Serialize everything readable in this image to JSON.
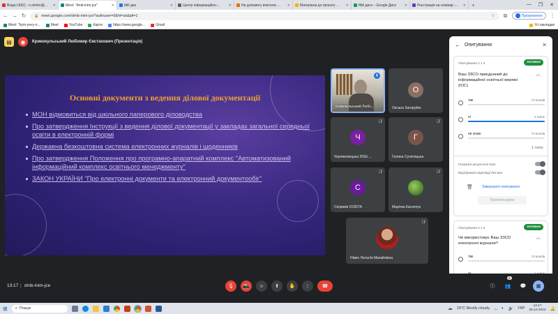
{
  "browser": {
    "tabs": [
      {
        "label": "Вхідні (692) - n.nimko@...",
        "color": "#d93025",
        "active": false
      },
      {
        "label": "Meet: \"dmb-inim-jce\"",
        "color": "#00897b",
        "active": true
      },
      {
        "label": "Mill дик",
        "color": "#1a73e8",
        "active": false
      },
      {
        "label": "Центр інформаційно-...",
        "color": "#5f6368",
        "active": false
      },
      {
        "label": "На допомогу вчителю ...",
        "color": "#e37400",
        "active": false
      },
      {
        "label": "Матеріали до проєкту ...",
        "color": "#f4b400",
        "active": false
      },
      {
        "label": "Мій диск – Google Диск",
        "color": "#0f9d58",
        "active": false
      },
      {
        "label": "Реєстрація на семінар -...",
        "color": "#673ab7",
        "active": false
      }
    ],
    "url": "meet.google.com/dmb-inim-jce?authuser=0&hl=uk&pli=1",
    "profile_label": "Призупинено",
    "bookmarks": [
      {
        "label": "Meet: \"bym-yevy-n...",
        "color": "#00897b"
      },
      {
        "label": "Meet",
        "color": "#00897b"
      },
      {
        "label": "YouTube",
        "color": "#ff0000"
      },
      {
        "label": "Карти",
        "color": "#34a853"
      },
      {
        "label": "https://www.google...",
        "color": "#4285f4"
      },
      {
        "label": "Gmail",
        "color": "#d93025"
      }
    ],
    "all_bookmarks": "Усі закладки"
  },
  "presenter": {
    "title": "Кривокульський Любомир Євстахович (Презентація)"
  },
  "slide": {
    "title": "Основні документи з ведення ділової документації",
    "items": [
      "МОН відмовиться від шкільного паперового діловодства",
      "Про затвердження Інструкції з ведення ділової документації у закладах загальної середньої освіти в електронній формі",
      "Державна безкоштовна система електронних журналів і щоденників",
      "Про затвердження Положення про програмно-апаратний комплекс \"Автоматизований інформаційний комплекс освітнього менеджменту\"",
      "ЗАКОН УКРАЇНИ \"Про електронні документи та електронний документообіг\""
    ]
  },
  "participants": [
    {
      "name": "Кривокульський Любо...",
      "type": "video"
    },
    {
      "name": "Оксана Загоруйко",
      "initial": "О",
      "color": "#8d6e63"
    },
    {
      "name": "Черчиковецька ЗОШ ...",
      "initial": "Ч",
      "color": "#7b1fa2"
    },
    {
      "name": "Галина Сулятицька",
      "initial": "Г",
      "color": "#795548"
    },
    {
      "name": "Скориків ОСВІТА",
      "initial": "С",
      "color": "#6a1b9a"
    },
    {
      "name": "Марічка Касянчук",
      "type": "photo"
    },
    {
      "name": "Німко Наталія Михайлівна",
      "type": "photo"
    }
  ],
  "panel": {
    "title": "Опитування",
    "poll1": {
      "meta": "Опитування 1 з 3",
      "status": "Активне",
      "question": "Ваш ЗЗСО приєднаний до інформаційної освітньої мережі (ІОС)",
      "options": [
        {
          "label": "так",
          "count": "0 голосів",
          "fraction": 0
        },
        {
          "label": "ні",
          "count": "1 голос",
          "fraction": 1
        },
        {
          "label": "не знаю",
          "count": "0 голосів",
          "fraction": 0
        }
      ],
      "total": "1 голос",
      "show_results": "Показати результати всім",
      "show_answers": "Відображати відповіді без мен",
      "end_button": "Завершити опитування",
      "vote_button": "Проголосувати"
    },
    "poll2": {
      "meta": "Опитування 2 з 3",
      "status": "Активне",
      "question": "Чи використовує Ваш ЗЗСО електронні журнали?",
      "options": [
        {
          "label": "так",
          "count": "0 голосів"
        },
        {
          "label": "ні",
          "count": "1 голос"
        }
      ]
    }
  },
  "bottom": {
    "time": "13:17",
    "meeting_code": "dmb-inim-jce",
    "participants_badge": "8"
  },
  "taskbar": {
    "search": "Пошук",
    "weather": "15°C Mostly cloudy",
    "lang": "УКР",
    "clock_time": "13:17",
    "clock_date": "26.10.2023"
  }
}
